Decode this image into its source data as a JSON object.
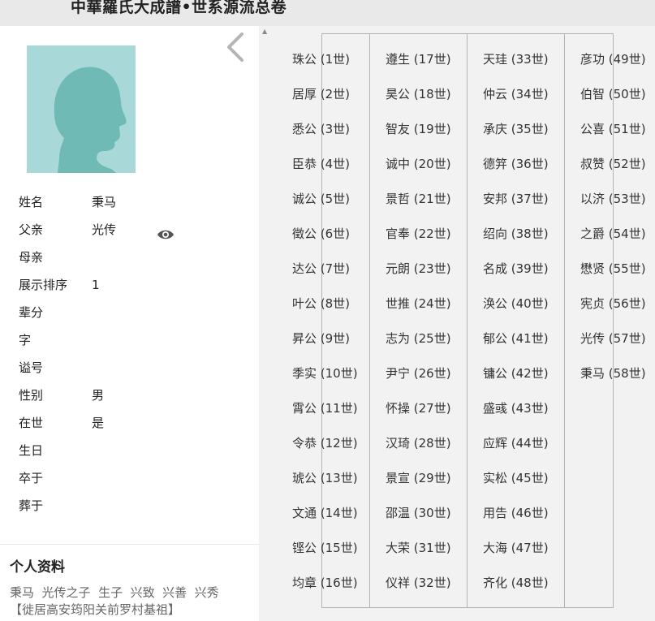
{
  "header": {
    "title": "中華羅氏大成譜•世系源流总卷"
  },
  "person": {
    "fields": [
      {
        "label": "姓名",
        "value": "秉马"
      },
      {
        "label": "父亲",
        "value": "光传"
      },
      {
        "label": "母亲",
        "value": ""
      },
      {
        "label": "展示排序",
        "value": "1"
      },
      {
        "label": "辈分",
        "value": ""
      },
      {
        "label": "字",
        "value": ""
      },
      {
        "label": "谥号",
        "value": ""
      },
      {
        "label": "性别",
        "value": "男"
      },
      {
        "label": "在世",
        "value": "是"
      },
      {
        "label": "生日",
        "value": ""
      },
      {
        "label": "卒于",
        "value": ""
      },
      {
        "label": "葬于",
        "value": ""
      }
    ]
  },
  "profile": {
    "title": "个人资料",
    "line1": "秉马  光传之子  生子  兴致  兴善  兴秀",
    "line2": "【徙居高安筠阳关前罗村基祖】"
  },
  "lineage": {
    "columns": [
      [
        "珠公 (1世)",
        "居厚 (2世)",
        "悉公 (3世)",
        "臣恭 (4世)",
        "诚公 (5世)",
        "徵公 (6世)",
        "达公 (7世)",
        "叶公 (8世)",
        "昇公 (9世)",
        "季实 (10世)",
        "霄公 (11世)",
        "令恭 (12世)",
        "琥公 (13世)",
        "文通 (14世)",
        "铿公 (15世)",
        "均章 (16世)"
      ],
      [
        "遵生 (17世)",
        "昊公 (18世)",
        "智友 (19世)",
        "诚中 (20世)",
        "景哲 (21世)",
        "官奉 (22世)",
        "元朗 (23世)",
        "世推 (24世)",
        "志为 (25世)",
        "尹宁 (26世)",
        "怀操 (27世)",
        "汉琦 (28世)",
        "景宣 (29世)",
        "邵温 (30世)",
        "大荣 (31世)",
        "仪祥 (32世)"
      ],
      [
        "天珪 (33世)",
        "仲云 (34世)",
        "承庆 (35世)",
        "德笄 (36世)",
        "安邦 (37世)",
        "绍向 (38世)",
        "名成 (39世)",
        "涣公 (40世)",
        "郁公 (41世)",
        "镛公 (42世)",
        "盛彧 (43世)",
        "应辉 (44世)",
        "实松 (45世)",
        "用告 (46世)",
        "大海 (47世)",
        "齐化 (48世)"
      ],
      [
        "彦功 (49世)",
        "伯智 (50世)",
        "公喜 (51世)",
        "叔赞 (52世)",
        "以济 (53世)",
        "之爵 (54世)",
        "懋贤 (55世)",
        "宪贞 (56世)",
        "光传 (57世)",
        "秉马 (58世)"
      ]
    ]
  },
  "colors": {
    "avatar_bg": "#a8d8d8",
    "avatar_silhouette": "#6fbab4",
    "panel_bg": "#f2f2f2",
    "topbar_bg": "#e9e9e9"
  }
}
